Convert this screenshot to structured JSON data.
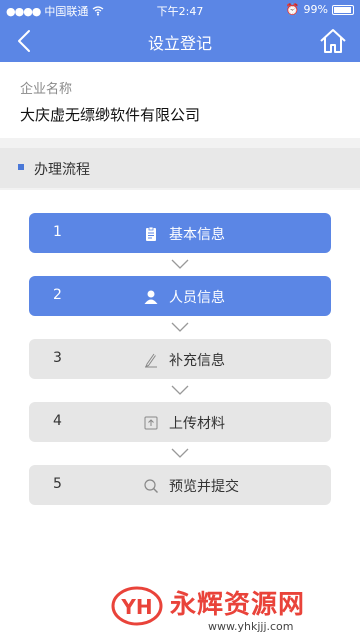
{
  "status_bar": {
    "carrier": "中国联通",
    "time": "下午2:47",
    "battery": "99%"
  },
  "nav": {
    "title": "设立登记",
    "back_icon": "chevron-left-icon",
    "home_icon": "home-icon"
  },
  "company": {
    "label": "企业名称",
    "value": "大庆虚无缥缈软件有限公司"
  },
  "section": {
    "title": "办理流程"
  },
  "steps": [
    {
      "number": "1",
      "label": "基本信息",
      "icon": "clipboard-icon",
      "active": true
    },
    {
      "number": "2",
      "label": "人员信息",
      "icon": "person-icon",
      "active": true
    },
    {
      "number": "3",
      "label": "补充信息",
      "icon": "pen-icon",
      "active": false
    },
    {
      "number": "4",
      "label": "上传材料",
      "icon": "upload-icon",
      "active": false
    },
    {
      "number": "5",
      "label": "预览并提交",
      "icon": "search-icon",
      "active": false
    }
  ],
  "watermark": {
    "brand": "永辉资源网",
    "url": "www.yhkjjj.com"
  },
  "colors": {
    "primary": "#5b86e5",
    "inactive": "#e6e6e6",
    "watermark": "#e9433a"
  }
}
